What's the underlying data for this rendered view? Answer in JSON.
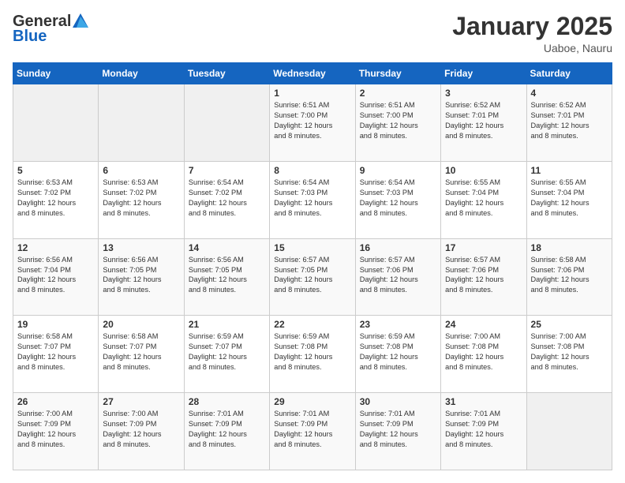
{
  "header": {
    "logo_general": "General",
    "logo_blue": "Blue",
    "month_title": "January 2025",
    "subtitle": "Uaboe, Nauru"
  },
  "weekdays": [
    "Sunday",
    "Monday",
    "Tuesday",
    "Wednesday",
    "Thursday",
    "Friday",
    "Saturday"
  ],
  "weeks": [
    [
      {
        "day": "",
        "info": ""
      },
      {
        "day": "",
        "info": ""
      },
      {
        "day": "",
        "info": ""
      },
      {
        "day": "1",
        "info": "Sunrise: 6:51 AM\nSunset: 7:00 PM\nDaylight: 12 hours\nand 8 minutes."
      },
      {
        "day": "2",
        "info": "Sunrise: 6:51 AM\nSunset: 7:00 PM\nDaylight: 12 hours\nand 8 minutes."
      },
      {
        "day": "3",
        "info": "Sunrise: 6:52 AM\nSunset: 7:01 PM\nDaylight: 12 hours\nand 8 minutes."
      },
      {
        "day": "4",
        "info": "Sunrise: 6:52 AM\nSunset: 7:01 PM\nDaylight: 12 hours\nand 8 minutes."
      }
    ],
    [
      {
        "day": "5",
        "info": "Sunrise: 6:53 AM\nSunset: 7:02 PM\nDaylight: 12 hours\nand 8 minutes."
      },
      {
        "day": "6",
        "info": "Sunrise: 6:53 AM\nSunset: 7:02 PM\nDaylight: 12 hours\nand 8 minutes."
      },
      {
        "day": "7",
        "info": "Sunrise: 6:54 AM\nSunset: 7:02 PM\nDaylight: 12 hours\nand 8 minutes."
      },
      {
        "day": "8",
        "info": "Sunrise: 6:54 AM\nSunset: 7:03 PM\nDaylight: 12 hours\nand 8 minutes."
      },
      {
        "day": "9",
        "info": "Sunrise: 6:54 AM\nSunset: 7:03 PM\nDaylight: 12 hours\nand 8 minutes."
      },
      {
        "day": "10",
        "info": "Sunrise: 6:55 AM\nSunset: 7:04 PM\nDaylight: 12 hours\nand 8 minutes."
      },
      {
        "day": "11",
        "info": "Sunrise: 6:55 AM\nSunset: 7:04 PM\nDaylight: 12 hours\nand 8 minutes."
      }
    ],
    [
      {
        "day": "12",
        "info": "Sunrise: 6:56 AM\nSunset: 7:04 PM\nDaylight: 12 hours\nand 8 minutes."
      },
      {
        "day": "13",
        "info": "Sunrise: 6:56 AM\nSunset: 7:05 PM\nDaylight: 12 hours\nand 8 minutes."
      },
      {
        "day": "14",
        "info": "Sunrise: 6:56 AM\nSunset: 7:05 PM\nDaylight: 12 hours\nand 8 minutes."
      },
      {
        "day": "15",
        "info": "Sunrise: 6:57 AM\nSunset: 7:05 PM\nDaylight: 12 hours\nand 8 minutes."
      },
      {
        "day": "16",
        "info": "Sunrise: 6:57 AM\nSunset: 7:06 PM\nDaylight: 12 hours\nand 8 minutes."
      },
      {
        "day": "17",
        "info": "Sunrise: 6:57 AM\nSunset: 7:06 PM\nDaylight: 12 hours\nand 8 minutes."
      },
      {
        "day": "18",
        "info": "Sunrise: 6:58 AM\nSunset: 7:06 PM\nDaylight: 12 hours\nand 8 minutes."
      }
    ],
    [
      {
        "day": "19",
        "info": "Sunrise: 6:58 AM\nSunset: 7:07 PM\nDaylight: 12 hours\nand 8 minutes."
      },
      {
        "day": "20",
        "info": "Sunrise: 6:58 AM\nSunset: 7:07 PM\nDaylight: 12 hours\nand 8 minutes."
      },
      {
        "day": "21",
        "info": "Sunrise: 6:59 AM\nSunset: 7:07 PM\nDaylight: 12 hours\nand 8 minutes."
      },
      {
        "day": "22",
        "info": "Sunrise: 6:59 AM\nSunset: 7:08 PM\nDaylight: 12 hours\nand 8 minutes."
      },
      {
        "day": "23",
        "info": "Sunrise: 6:59 AM\nSunset: 7:08 PM\nDaylight: 12 hours\nand 8 minutes."
      },
      {
        "day": "24",
        "info": "Sunrise: 7:00 AM\nSunset: 7:08 PM\nDaylight: 12 hours\nand 8 minutes."
      },
      {
        "day": "25",
        "info": "Sunrise: 7:00 AM\nSunset: 7:08 PM\nDaylight: 12 hours\nand 8 minutes."
      }
    ],
    [
      {
        "day": "26",
        "info": "Sunrise: 7:00 AM\nSunset: 7:09 PM\nDaylight: 12 hours\nand 8 minutes."
      },
      {
        "day": "27",
        "info": "Sunrise: 7:00 AM\nSunset: 7:09 PM\nDaylight: 12 hours\nand 8 minutes."
      },
      {
        "day": "28",
        "info": "Sunrise: 7:01 AM\nSunset: 7:09 PM\nDaylight: 12 hours\nand 8 minutes."
      },
      {
        "day": "29",
        "info": "Sunrise: 7:01 AM\nSunset: 7:09 PM\nDaylight: 12 hours\nand 8 minutes."
      },
      {
        "day": "30",
        "info": "Sunrise: 7:01 AM\nSunset: 7:09 PM\nDaylight: 12 hours\nand 8 minutes."
      },
      {
        "day": "31",
        "info": "Sunrise: 7:01 AM\nSunset: 7:09 PM\nDaylight: 12 hours\nand 8 minutes."
      },
      {
        "day": "",
        "info": ""
      }
    ]
  ]
}
